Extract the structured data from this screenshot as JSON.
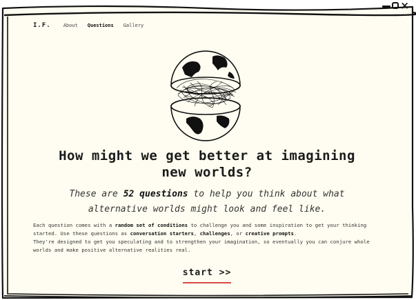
{
  "window": {
    "controls": {
      "minimize_icon": "minus-icon",
      "maximize_icon": "square-icon",
      "close_label": "×"
    }
  },
  "nav": {
    "logo": "I.F.",
    "links": [
      {
        "label": "About",
        "active": false
      },
      {
        "label": "Questions",
        "active": true
      },
      {
        "label": "Gallery",
        "active": false
      }
    ]
  },
  "hero": {
    "illustration_icon": "split-globe-scribble-icon",
    "headline_line1": "How might we get better at imagining",
    "headline_line2": "new worlds?",
    "sub_pre": "These are ",
    "sub_bold": "52 questions",
    "sub_post_line1": " to help you think about what",
    "sub_line2": "alternative worlds might look and feel like."
  },
  "body": {
    "p1_a": "Each question comes with a ",
    "p1_b": "random set of conditions",
    "p1_c": " to challenge you and some inspiration to get your thinking started. Use these questions as ",
    "p1_d": "conversation starters",
    "p1_e": ", ",
    "p1_f": "challenges",
    "p1_g": ", or ",
    "p1_h": "creative prompts",
    "p1_i": ".",
    "p2": "They're designed to get you speculating and to strengthen your imagination, so eventually you can conjure whole worlds and make positive alternative realities real."
  },
  "cta": {
    "label": "start >>",
    "underline_color": "#d94a4a"
  },
  "colors": {
    "background": "#fffdf1",
    "frame": "#111111",
    "accent": "#d94a4a"
  }
}
